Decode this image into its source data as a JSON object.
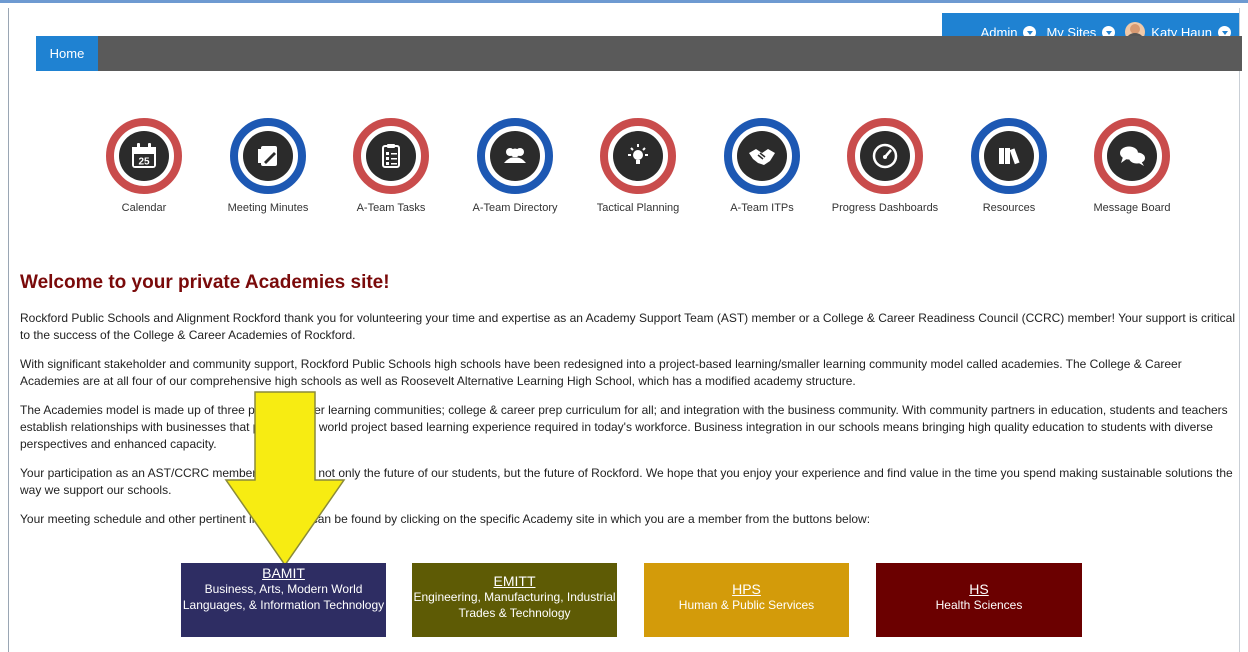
{
  "suitebar": {
    "items": [
      {
        "label": "Admin"
      },
      {
        "label": "My Sites"
      },
      {
        "label": "Katy Haun"
      }
    ]
  },
  "nav": {
    "home": "Home"
  },
  "tiles": [
    {
      "label": "Calendar",
      "icon": "calendar-icon",
      "ring": "#c94c4c"
    },
    {
      "label": "Meeting Minutes",
      "icon": "notepad-icon",
      "ring": "#1d58b3"
    },
    {
      "label": "A-Team Tasks",
      "icon": "checklist-icon",
      "ring": "#c94c4c"
    },
    {
      "label": "A-Team Directory",
      "icon": "people-icon",
      "ring": "#1d58b3"
    },
    {
      "label": "Tactical Planning",
      "icon": "lightbulb-icon",
      "ring": "#c94c4c"
    },
    {
      "label": "A-Team ITPs",
      "icon": "handshake-icon",
      "ring": "#1d58b3"
    },
    {
      "label": "Progress Dashboards",
      "icon": "gauge-icon",
      "ring": "#c94c4c"
    },
    {
      "label": "Resources",
      "icon": "books-icon",
      "ring": "#1d58b3"
    },
    {
      "label": "Message Board",
      "icon": "chat-bubbles-icon",
      "ring": "#c94c4c"
    }
  ],
  "welcome": {
    "title": "Welcome to your private Academies site!",
    "p1": "Rockford Public Schools and Alignment Rockford thank you for volunteering your time and expertise as an Academy Support Team (AST) member or a College & Career Readiness Council (CCRC) member! Your support is critical to the success of the College & Career Academies of Rockford.",
    "p2": "With significant stakeholder and community support, Rockford Public Schools high schools have been redesigned into a project-based learning/smaller learning community model called academies.  The College & Career Academies are at all four of our comprehensive high schools as well as Roosevelt Alternative Learning High School, which has a modified academy structure.",
    "p3": "The Academies model is made up of three pillars: smaller learning communities; college & career prep curriculum for all; and integration with the business community. With community partners in education, students and teachers establish relationships with businesses that provide real world project based learning experience required in today's workforce. Business integration in our schools means bringing high quality education to students with diverse perspectives and enhanced capacity.",
    "p4": "Your participation as an AST/CCRC member will impact not only the future of our students, but the future of Rockford. We hope that you enjoy your experience and find value in the time you spend making sustainable solutions the way we support our schools.",
    "p5": "Your meeting schedule and other pertinent information can be found by clicking on the specific Academy site in which you are a member from the buttons below:"
  },
  "academies": [
    {
      "acronym": "BAMIT",
      "name": "Business, Arts, Modern World Languages, & Information Technology",
      "color": "#2e2d63"
    },
    {
      "acronym": "EMITT",
      "name": "Engineering, Manufacturing, Industrial Trades & Technology",
      "color": "#5e5b05"
    },
    {
      "acronym": "HPS",
      "name": "Human & Public Services",
      "color": "#d39b0a"
    },
    {
      "acronym": "HS",
      "name": "Health Sciences",
      "color": "#6b0000"
    }
  ],
  "colors": {
    "accent_blue": "#1f82d2",
    "nav_gray": "#5a5a5a",
    "ring_red": "#c94c4c",
    "ring_blue": "#1d58b3",
    "welcome_red": "#7a0a0a",
    "arrow_yellow": "#f7ec12"
  }
}
